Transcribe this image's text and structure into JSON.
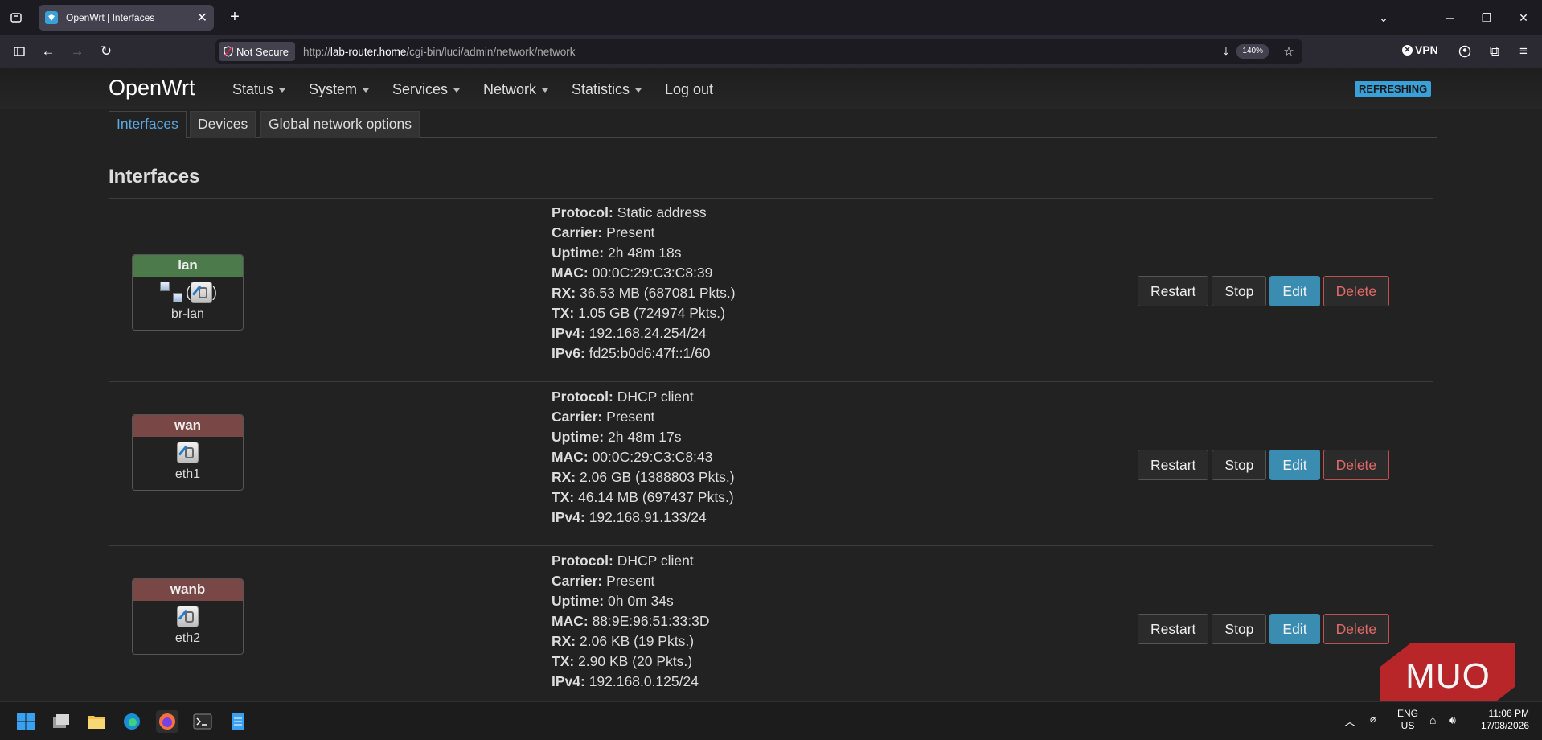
{
  "browser": {
    "tab_title": "OpenWrt | Interfaces",
    "security_label": "Not Secure",
    "url_prefix": "http://",
    "url_host": "lab-router.home",
    "url_path": "/cgi-bin/luci/admin/network/network",
    "zoom": "140%",
    "vpn_label": "VPN"
  },
  "header": {
    "brand": "OpenWrt",
    "menu": [
      "Status",
      "System",
      "Services",
      "Network",
      "Statistics"
    ],
    "logout": "Log out",
    "badge": "REFRESHING"
  },
  "subtabs": [
    "Interfaces",
    "Devices",
    "Global network options"
  ],
  "section_title": "Interfaces",
  "interfaces": [
    {
      "name": "lan",
      "device": "br-lan",
      "color": "#4d7a4a",
      "details": [
        {
          "label": "Protocol:",
          "value": "Static address"
        },
        {
          "label": "Carrier:",
          "value": "Present"
        },
        {
          "label": "Uptime:",
          "value": "2h 48m 18s"
        },
        {
          "label": "MAC:",
          "value": "00:0C:29:C3:C8:39"
        },
        {
          "label": "RX:",
          "value": "36.53 MB (687081 Pkts.)"
        },
        {
          "label": "TX:",
          "value": "1.05 GB (724974 Pkts.)"
        },
        {
          "label": "IPv4:",
          "value": "192.168.24.254/24"
        },
        {
          "label": "IPv6:",
          "value": "fd25:b0d6:47f::1/60"
        }
      ]
    },
    {
      "name": "wan",
      "device": "eth1",
      "color": "#7a4747",
      "details": [
        {
          "label": "Protocol:",
          "value": "DHCP client"
        },
        {
          "label": "Carrier:",
          "value": "Present"
        },
        {
          "label": "Uptime:",
          "value": "2h 48m 17s"
        },
        {
          "label": "MAC:",
          "value": "00:0C:29:C3:C8:43"
        },
        {
          "label": "RX:",
          "value": "2.06 GB (1388803 Pkts.)"
        },
        {
          "label": "TX:",
          "value": "46.14 MB (697437 Pkts.)"
        },
        {
          "label": "IPv4:",
          "value": "192.168.91.133/24"
        }
      ]
    },
    {
      "name": "wanb",
      "device": "eth2",
      "color": "#7a4747",
      "details": [
        {
          "label": "Protocol:",
          "value": "DHCP client"
        },
        {
          "label": "Carrier:",
          "value": "Present"
        },
        {
          "label": "Uptime:",
          "value": "0h 0m 34s"
        },
        {
          "label": "MAC:",
          "value": "88:9E:96:51:33:3D"
        },
        {
          "label": "RX:",
          "value": "2.06 KB (19 Pkts.)"
        },
        {
          "label": "TX:",
          "value": "2.90 KB (20 Pkts.)"
        },
        {
          "label": "IPv4:",
          "value": "192.168.0.125/24"
        }
      ]
    }
  ],
  "actions": {
    "restart": "Restart",
    "stop": "Stop",
    "edit": "Edit",
    "delete": "Delete"
  },
  "watermark": "MUO",
  "taskbar": {
    "lang_top": "ENG",
    "lang_bottom": "US",
    "time": "11:06 PM",
    "date": "17/08/2026"
  }
}
